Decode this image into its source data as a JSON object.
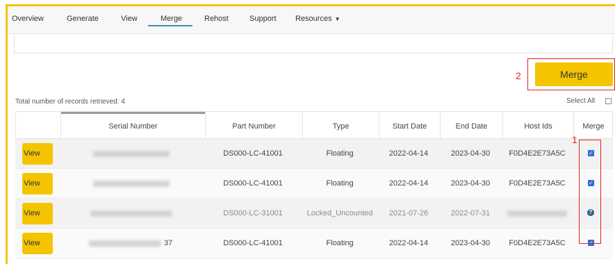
{
  "nav": {
    "items": [
      "Overview",
      "Generate",
      "View",
      "Merge",
      "Rehost",
      "Support",
      "Resources"
    ],
    "active": "Merge"
  },
  "merge_button": {
    "label": "Merge"
  },
  "annotations": {
    "step1": "1",
    "step2": "2"
  },
  "records_count": "Total number of records retrieved: 4",
  "select_all": "Select All",
  "table": {
    "columns": [
      "",
      "Serial Number",
      "Part Number",
      "Type",
      "Start Date",
      "End Date",
      "Host Ids",
      "Merge"
    ],
    "rows": [
      {
        "view": "View",
        "serial": "",
        "part": "DS000-LC-41001",
        "type": "Floating",
        "start": "2022-04-14",
        "end": "2023-04-30",
        "host": "F0D4E2E73A5C",
        "merge": "checked",
        "muted": false
      },
      {
        "view": "View",
        "serial": "",
        "part": "DS000-LC-41001",
        "type": "Floating",
        "start": "2022-04-14",
        "end": "2023-04-30",
        "host": "F0D4E2E73A5C",
        "merge": "checked",
        "muted": false
      },
      {
        "view": "View",
        "serial": "",
        "part": "DS000-LC-31001",
        "type": "Locked_Uncounted",
        "start": "2021-07-26",
        "end": "2022-07-31",
        "host": "",
        "merge": "help",
        "muted": true
      },
      {
        "view": "View",
        "serial": "37",
        "part": "DS000-LC-41001",
        "type": "Floating",
        "start": "2022-04-14",
        "end": "2023-04-30",
        "host": "F0D4E2E73A5C",
        "merge": "checked",
        "muted": false
      }
    ]
  },
  "icons": {
    "merge_checked": "checkbox-checked-icon",
    "merge_help": "help-circle-icon",
    "dropdown": "caret-down-icon"
  },
  "colors": {
    "accent": "#f5c400",
    "annotation": "#e02020",
    "checkbox": "#2d6fd6",
    "tab_underline": "#3d8fb8"
  }
}
